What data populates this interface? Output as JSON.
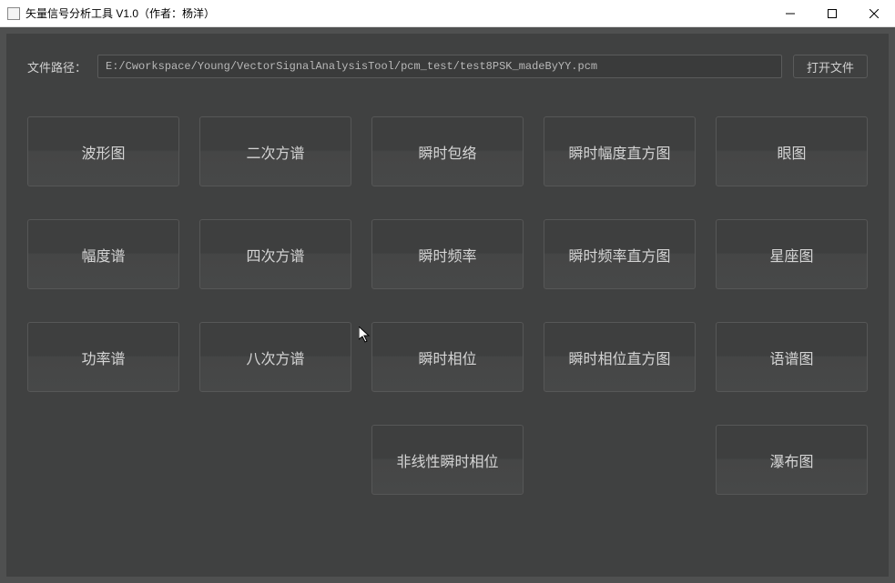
{
  "window": {
    "title": "矢量信号分析工具 V1.0（作者：杨洋）"
  },
  "file": {
    "label": "文件路径：",
    "path": "E:/Cworkspace/Young/VectorSignalAnalysisTool/pcm_test/test8PSK_madeByYY.pcm",
    "open_button": "打开文件"
  },
  "buttons": {
    "r0c0": "波形图",
    "r0c1": "二次方谱",
    "r0c2": "瞬时包络",
    "r0c3": "瞬时幅度直方图",
    "r0c4": "眼图",
    "r1c0": "幅度谱",
    "r1c1": "四次方谱",
    "r1c2": "瞬时频率",
    "r1c3": "瞬时频率直方图",
    "r1c4": "星座图",
    "r2c0": "功率谱",
    "r2c1": "八次方谱",
    "r2c2": "瞬时相位",
    "r2c3": "瞬时相位直方图",
    "r2c4": "语谱图",
    "r3c2": "非线性瞬时相位",
    "r3c4": "瀑布图"
  }
}
